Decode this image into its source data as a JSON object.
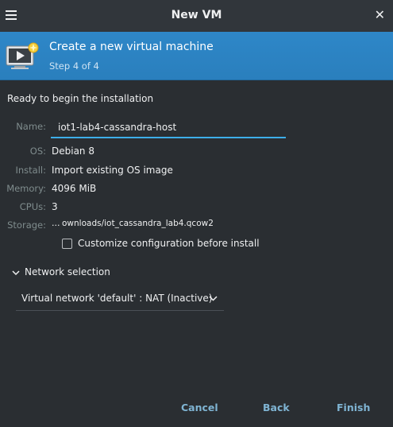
{
  "window": {
    "title": "New VM"
  },
  "icons": {
    "menu": "hamburger-menu-icon",
    "close": "close-icon",
    "vm": "virtual-machine-monitor-icon",
    "chevron": "chevron-down-icon"
  },
  "banner": {
    "title": "Create a new virtual machine",
    "step": "Step 4 of 4"
  },
  "summary": {
    "heading": "Ready to begin the installation",
    "name_label": "Name:",
    "name_value": "iot1-lab4-cassandra-host",
    "os_label": "OS:",
    "os_value": "Debian 8",
    "install_label": "Install:",
    "install_value": "Import existing OS image",
    "memory_label": "Memory:",
    "memory_value": "4096 MiB",
    "cpus_label": "CPUs:",
    "cpus_value": "3",
    "storage_label": "Storage:",
    "storage_ellipsis": "...",
    "storage_value": "ownloads/iot_cassandra_lab4.qcow2"
  },
  "customize": {
    "label": "Customize configuration before install",
    "checked": false
  },
  "network": {
    "toggle_label": "Network selection",
    "selected": "Virtual network 'default' : NAT (Inactive)"
  },
  "buttons": {
    "cancel": "Cancel",
    "back": "Back",
    "finish": "Finish"
  },
  "colors": {
    "background": "#2a2e32",
    "titlebar": "#31363b",
    "banner": "#2a7fbd",
    "accent": "#3daee9",
    "button_text": "#7fb4d3",
    "label": "#7f8c8d"
  }
}
